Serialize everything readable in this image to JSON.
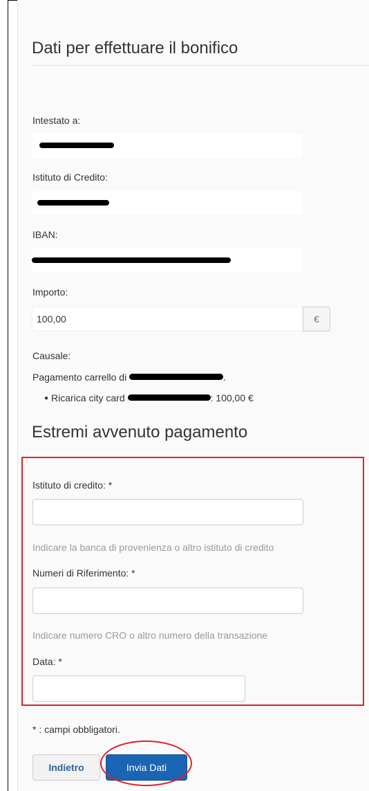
{
  "transfer_details": {
    "title": "Dati per effettuare il bonifico",
    "holder_label": "Intestato a:",
    "bank_label": "Istituto di Credito:",
    "iban_label": "IBAN:",
    "amount_label": "Importo:",
    "amount_value": "100,00",
    "currency_symbol": "€",
    "reason_label": "Causale:",
    "reason_text": "Pagamento carrello di",
    "reason_suffix": ".",
    "item_text": "Ricarica city card",
    "item_amount": ": 100,00 €"
  },
  "payment_confirmation": {
    "title": "Estremi avvenuto pagamento",
    "bank_field_label": "Istituto di credito: *",
    "bank_field_value": "",
    "bank_field_help": "Indicare la banca di provenienza o altro istituto di credito",
    "reference_field_label": "Numeri di Riferimento: *",
    "reference_field_value": "",
    "reference_field_help": "Indicare numero CRO o altro numero della transazione",
    "date_field_label": "Data: *",
    "date_field_value": ""
  },
  "footnote": "* : campi obbligatori.",
  "buttons": {
    "back_label": "Indietro",
    "submit_label": "Invia Dati"
  },
  "colors": {
    "accent_blue": "#1a64b4",
    "annotation_red": "#e0202a"
  }
}
